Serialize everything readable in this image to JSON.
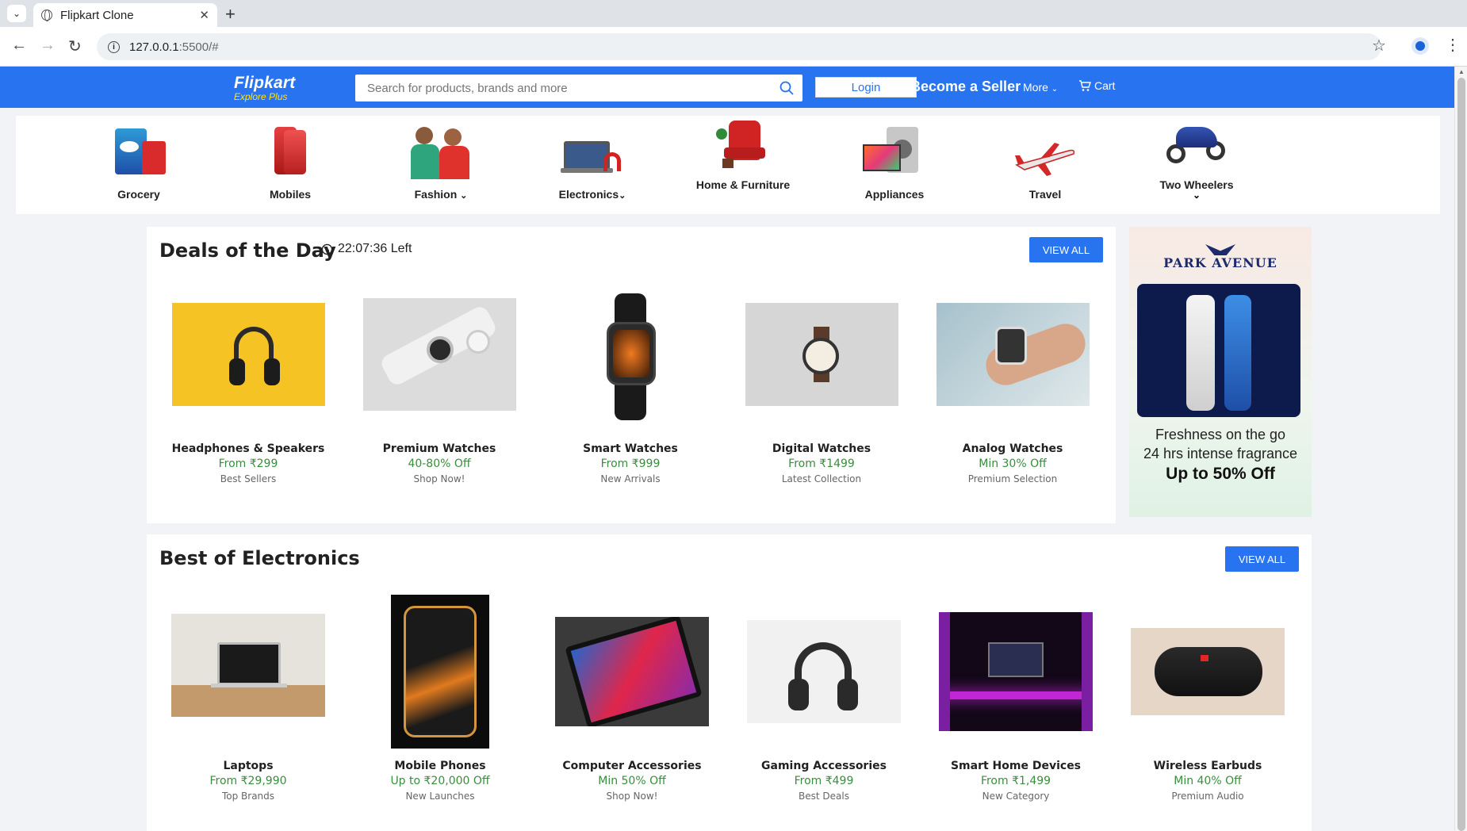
{
  "browser": {
    "tab_title": "Flipkart Clone",
    "url_host": "127.0.0.1",
    "url_rest": ":5500/#"
  },
  "header": {
    "logo": "Flipkart",
    "logo_tagline": "Explore Plus",
    "search_placeholder": "Search for products, brands and more",
    "login_label": "Login",
    "seller_label": "Become a Seller",
    "more_label": "More",
    "cart_label": "Cart",
    "brand_color": "#2874f0"
  },
  "categories": [
    {
      "label": "Grocery",
      "icon": "grocery-icon"
    },
    {
      "label": "Mobiles",
      "icon": "mobiles-icon"
    },
    {
      "label": "Fashion",
      "icon": "fashion-icon",
      "dropdown": true
    },
    {
      "label": "Electronics",
      "icon": "electronics-icon",
      "dropdown": true
    },
    {
      "label": "Home & Furniture",
      "icon": "furniture-icon"
    },
    {
      "label": "Appliances",
      "icon": "appliances-icon"
    },
    {
      "label": "Travel",
      "icon": "travel-icon"
    },
    {
      "label": "Two Wheelers",
      "icon": "two-wheelers-icon",
      "dropdown": true
    }
  ],
  "deals": {
    "title": "Deals of the Day",
    "timer": "22:07:36 Left",
    "view_all": "VIEW ALL",
    "items": [
      {
        "name": "Headphones & Speakers",
        "offer": "From ₹299",
        "sub": "Best Sellers"
      },
      {
        "name": "Premium Watches",
        "offer": "40-80% Off",
        "sub": "Shop Now!"
      },
      {
        "name": "Smart Watches",
        "offer": "From ₹999",
        "sub": "New Arrivals"
      },
      {
        "name": "Digital Watches",
        "offer": "From ₹1499",
        "sub": "Latest Collection"
      },
      {
        "name": "Analog Watches",
        "offer": "Min 30% Off",
        "sub": "Premium Selection"
      }
    ]
  },
  "ad": {
    "brand": "PARK AVENUE",
    "line1": "Freshness on the go",
    "line2": "24 hrs intense fragrance",
    "line3": "Up to 50% Off"
  },
  "electronics": {
    "title": "Best of Electronics",
    "view_all": "VIEW ALL",
    "items": [
      {
        "name": "Laptops",
        "offer": "From ₹29,990",
        "sub": "Top Brands"
      },
      {
        "name": "Mobile Phones",
        "offer": "Up to ₹20,000 Off",
        "sub": "New Launches"
      },
      {
        "name": "Computer Accessories",
        "offer": "Min 50% Off",
        "sub": "Shop Now!"
      },
      {
        "name": "Gaming Accessories",
        "offer": "From ₹499",
        "sub": "Best Deals"
      },
      {
        "name": "Smart Home Devices",
        "offer": "From ₹1,499",
        "sub": "New Category"
      },
      {
        "name": "Wireless Earbuds",
        "offer": "Min 40% Off",
        "sub": "Premium Audio"
      }
    ]
  }
}
